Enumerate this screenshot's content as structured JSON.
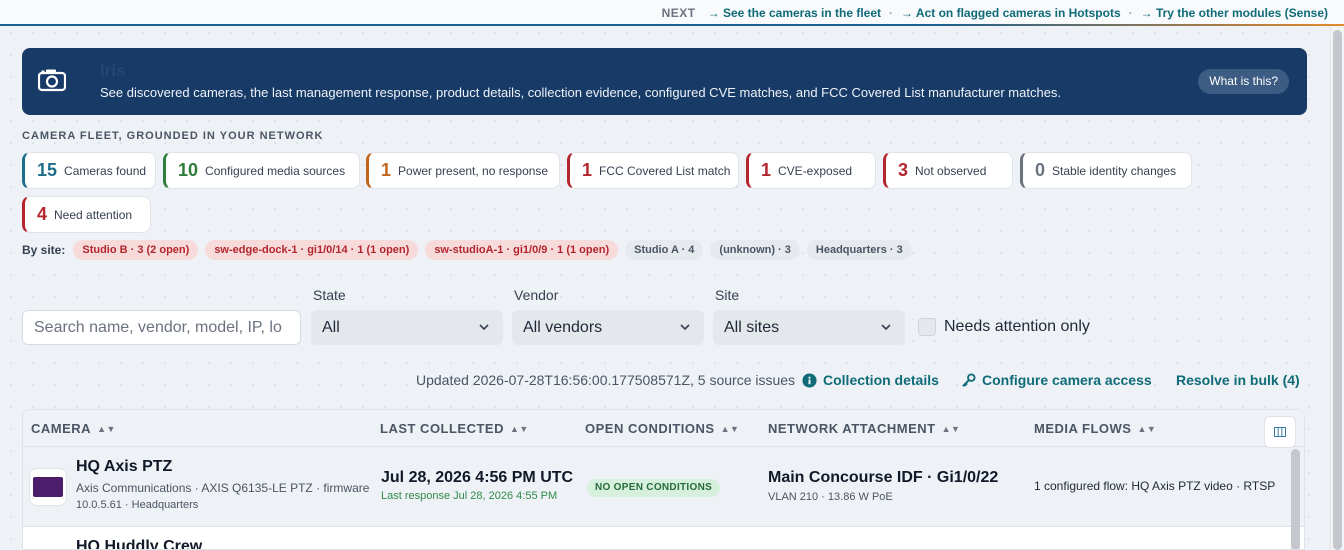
{
  "topbar": {
    "next_label": "NEXT",
    "links": [
      "→ See the cameras in the fleet",
      "→ Act on flagged cameras in Hotspots",
      "→ Try the other modules (Sense)"
    ],
    "separator": "·"
  },
  "banner": {
    "icon": "camera-icon",
    "title": "Iris",
    "description": "See discovered cameras, the last management response, product details, collection evidence, configured CVE matches, and FCC Covered List manufacturer matches.",
    "what_button": "What is this?"
  },
  "fleet_heading": "CAMERA FLEET, GROUNDED IN YOUR NETWORK",
  "stats": [
    {
      "num": "15",
      "label": "Cameras found",
      "color": "#1d6f8a"
    },
    {
      "num": "10",
      "label": "Configured media sources",
      "color": "#2e7d3a"
    },
    {
      "num": "1",
      "label": "Power present, no response",
      "color": "#c0651b"
    },
    {
      "num": "1",
      "label": "FCC Covered List match",
      "color": "#b3262d"
    },
    {
      "num": "1",
      "label": "CVE-exposed",
      "color": "#b3262d"
    },
    {
      "num": "3",
      "label": "Not observed",
      "color": "#b3262d"
    },
    {
      "num": "0",
      "label": "Stable identity changes",
      "color": "#6b7280"
    },
    {
      "num": "4",
      "label": "Need attention",
      "color": "#b3262d"
    }
  ],
  "sites": {
    "label": "By site:",
    "chips": [
      {
        "text": "Studio B · 3 (2 open)",
        "alert": true
      },
      {
        "text": "sw-edge-dock-1 · gi1/0/14 · 1 (1 open)",
        "alert": true
      },
      {
        "text": "sw-studioA-1 · gi1/0/9 · 1 (1 open)",
        "alert": true
      },
      {
        "text": "Studio A · 4",
        "alert": false
      },
      {
        "text": "(unknown) · 3",
        "alert": false
      },
      {
        "text": "Headquarters · 3",
        "alert": false
      }
    ]
  },
  "filters": {
    "search_placeholder": "Search name, vendor, model, IP, lo",
    "state_label": "State",
    "state_value": "All",
    "vendor_label": "Vendor",
    "vendor_value": "All vendors",
    "site_label": "Site",
    "site_value": "All sites",
    "attention_label": "Needs attention only"
  },
  "status": {
    "updated": "Updated 2026-07-28T16:56:00.177508571Z, 5 source issues",
    "collection_details": "Collection details",
    "configure_access": "Configure camera access",
    "resolve_bulk": "Resolve in bulk (4)"
  },
  "table": {
    "columns": [
      "CAMERA",
      "LAST COLLECTED",
      "OPEN CONDITIONS",
      "NETWORK ATTACHMENT",
      "MEDIA FLOWS"
    ],
    "rows": [
      {
        "name": "HQ Axis PTZ",
        "detail": "Axis Communications · AXIS Q6135-LE PTZ · firmware",
        "detail2": "10.0.5.61 · Headquarters",
        "last_collected": "Jul 28, 2026 4:56 PM UTC",
        "last_response": "Last response Jul 28, 2026 4:55 PM",
        "open_conditions": "NO OPEN CONDITIONS",
        "network": "Main Concourse IDF · Gi1/0/22",
        "network_sub": "VLAN 210 · 13.86 W PoE",
        "media_flows": "1 configured flow: HQ Axis PTZ video · RTSP"
      },
      {
        "name": "HQ Huddly Crew"
      }
    ]
  }
}
